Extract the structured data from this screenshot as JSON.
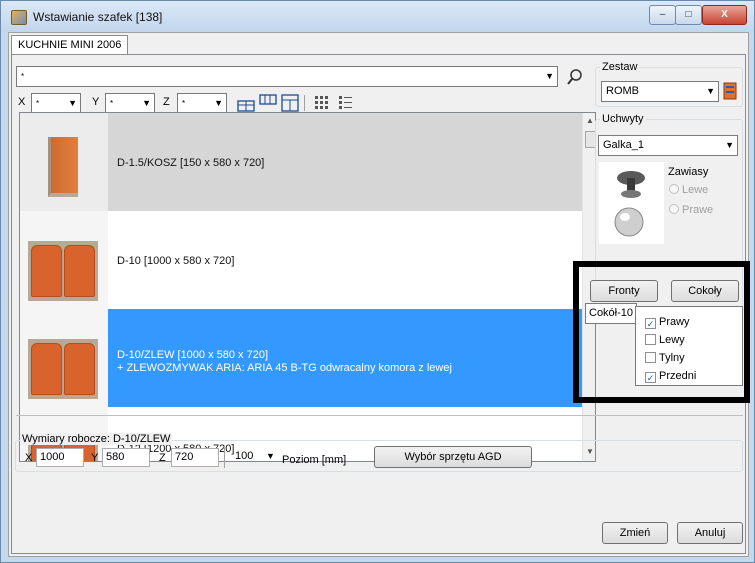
{
  "window": {
    "title": "Wstawianie szafek [138]",
    "controls": {
      "minimize": "–",
      "maximize": "□",
      "close": "X"
    }
  },
  "tab": {
    "label": "KUCHNIE MINI 2006"
  },
  "filters": {
    "main_value": "*",
    "x_label": "X",
    "x_value": "*",
    "y_label": "Y",
    "y_value": "*",
    "z_label": "Z",
    "z_value": "*"
  },
  "list": {
    "items": [
      {
        "name": "D-1.5/KOSZ  [150 x 580 x 720]",
        "extra": ""
      },
      {
        "name": "D-10  [1000 x 580 x 720]",
        "extra": ""
      },
      {
        "name": "D-10/ZLEW  [1000 x 580 x 720]",
        "extra": "+ ZLEWOZMYWAK ARIA: ARIA 45 B-TG odwracalny komora z lewej"
      },
      {
        "name": "D-12  [1200 x 580 x 720]",
        "extra": ""
      }
    ],
    "selected_index": 2
  },
  "zestaw": {
    "title": "Zestaw",
    "value": "ROMB"
  },
  "uchwyty": {
    "title": "Uchwyty",
    "value": "Galka_1",
    "zawiasy_label": "Zawiasy",
    "lewe": "Lewe",
    "prawe": "Prawe"
  },
  "buttons": {
    "fronty": "Fronty",
    "cokoly": "Cokoły",
    "cokol_combo": "Cokół-10"
  },
  "cokoly_menu": {
    "items": [
      {
        "label": "Prawy",
        "checked": true
      },
      {
        "label": "Lewy",
        "checked": false
      },
      {
        "label": "Tylny",
        "checked": false
      },
      {
        "label": "Przedni",
        "checked": true
      }
    ]
  },
  "wymiary": {
    "title": "Wymiary robocze: D-10/ZLEW",
    "x_label": "X",
    "x_value": "1000",
    "y_label": "Y",
    "y_value": "580",
    "z_label": "Z",
    "z_value": "720",
    "poziom_value": "100",
    "poziom_label": "Poziom [mm]",
    "agd_button": "Wybór sprzętu AGD"
  },
  "footer": {
    "zmien": "Zmień",
    "anuluj": "Anuluj"
  },
  "colors": {
    "selection": "#3399ff",
    "highlight_frame": "#000000",
    "cabinet_front": "#d9632c"
  }
}
